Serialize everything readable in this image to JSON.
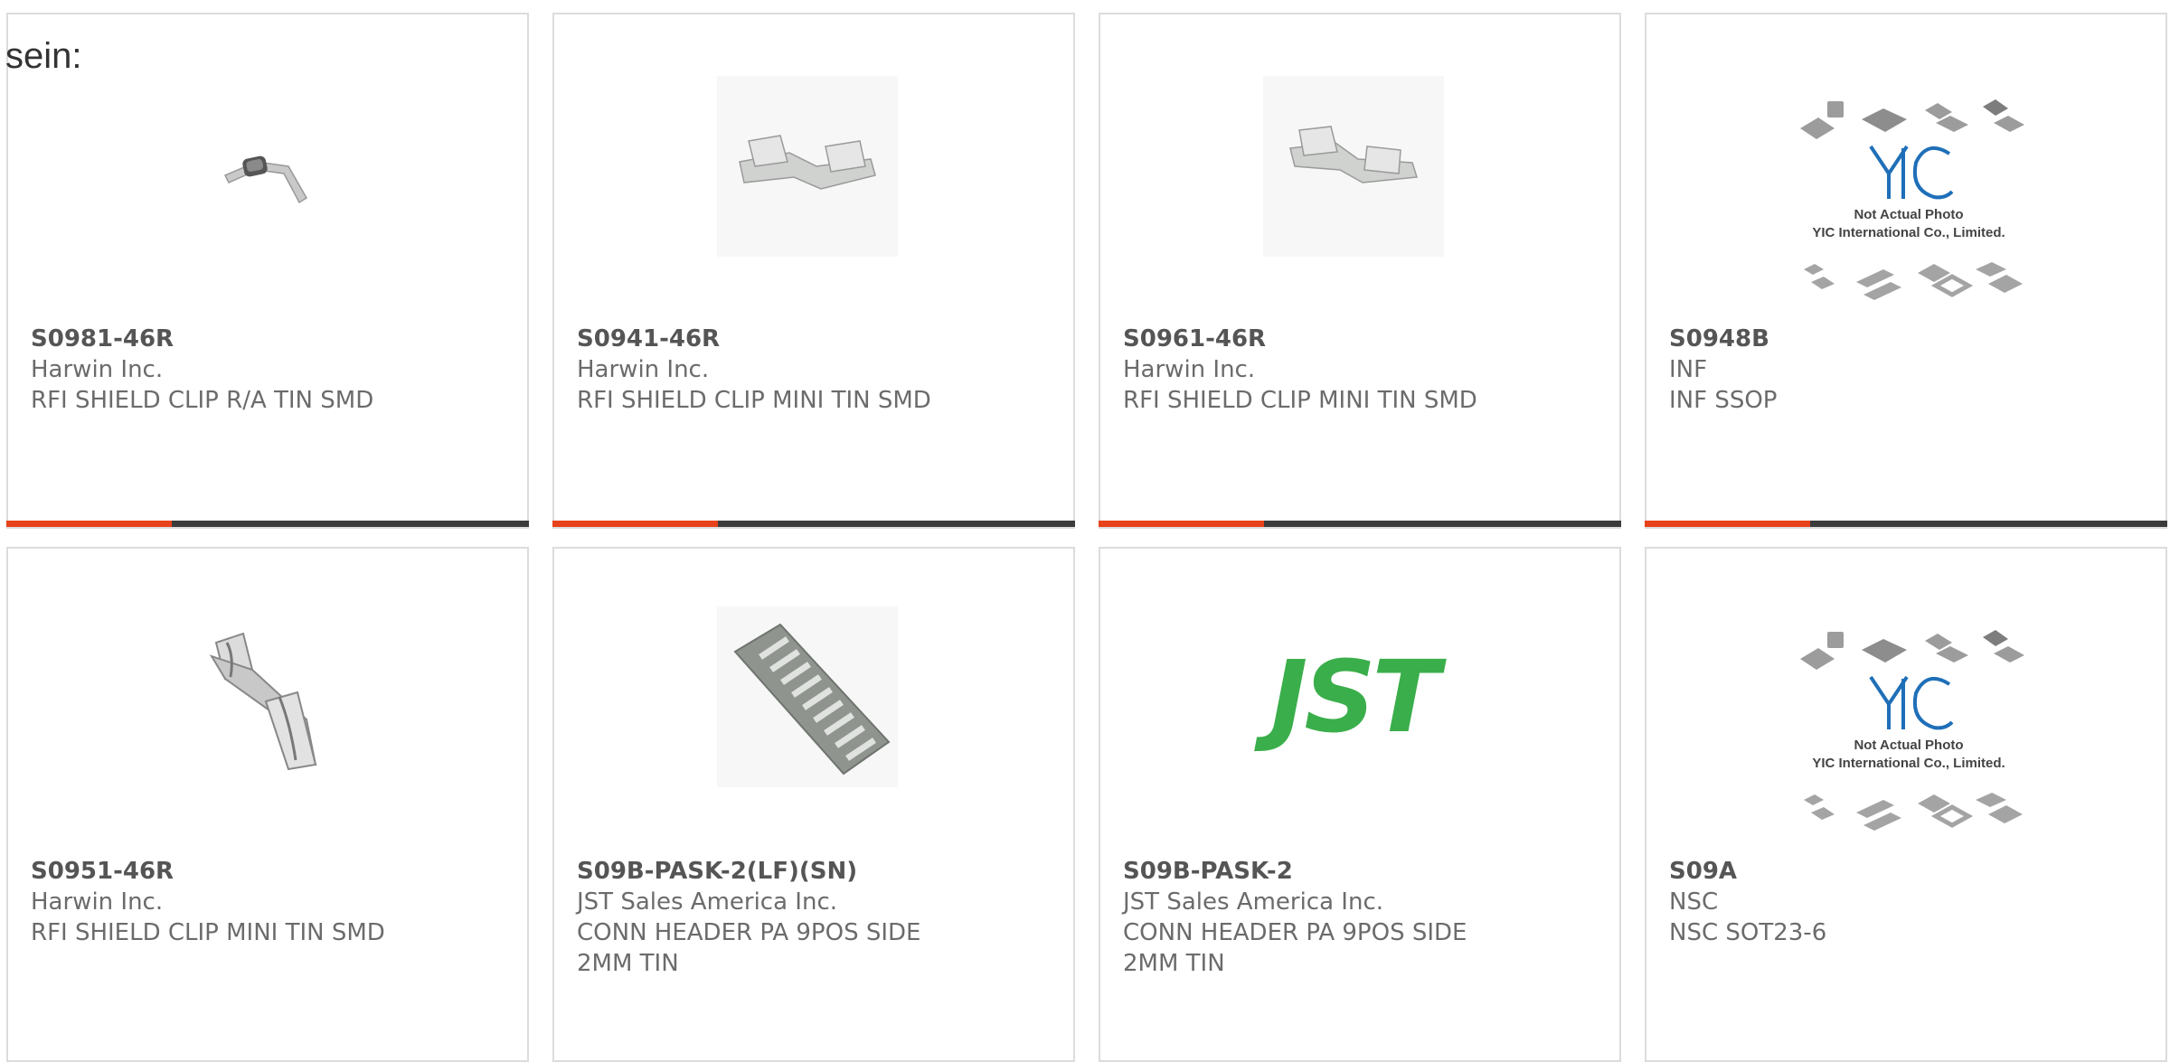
{
  "intro": "sein:",
  "colors": {
    "accent": "#e8421a",
    "bar": "#3b3b3b",
    "jst_green": "#3aae4a",
    "yic_blue": "#1f6fb8"
  },
  "products": [
    {
      "part": "S0981-46R",
      "manufacturer": "Harwin Inc.",
      "description": "RFI SHIELD CLIP R/A TIN SMD",
      "image": "shield-clip-ra-icon"
    },
    {
      "part": "S0941-46R",
      "manufacturer": "Harwin Inc.",
      "description": "RFI SHIELD CLIP MINI TIN SMD",
      "image": "shield-clip-mini-icon"
    },
    {
      "part": "S0961-46R",
      "manufacturer": "Harwin Inc.",
      "description": "RFI SHIELD CLIP MINI TIN SMD",
      "image": "shield-clip-mini-icon"
    },
    {
      "part": "S0948B",
      "manufacturer": "INF",
      "description": "INF SSOP",
      "image": "placeholder",
      "placeholder_line1": "Not Actual Photo",
      "placeholder_line2": "YIC International Co., Limited."
    },
    {
      "part": "S0951-46R",
      "manufacturer": "Harwin Inc.",
      "description": "RFI SHIELD CLIP MINI TIN SMD",
      "image": "shield-clip-large-icon"
    },
    {
      "part": "S09B-PASK-2(LF)(SN)",
      "manufacturer": "JST Sales America Inc.",
      "description_line1": "CONN HEADER PA 9POS SIDE",
      "description_line2": "2MM TIN",
      "image": "connector-header-icon"
    },
    {
      "part": "S09B-PASK-2",
      "manufacturer": "JST Sales America Inc.",
      "description_line1": "CONN HEADER PA 9POS SIDE",
      "description_line2": "2MM TIN",
      "image": "jst-logo",
      "logo_text": "JST"
    },
    {
      "part": "S09A",
      "manufacturer": "NSC",
      "description": "NSC SOT23-6",
      "image": "placeholder",
      "placeholder_line1": "Not Actual Photo",
      "placeholder_line2": "YIC International Co., Limited."
    }
  ]
}
